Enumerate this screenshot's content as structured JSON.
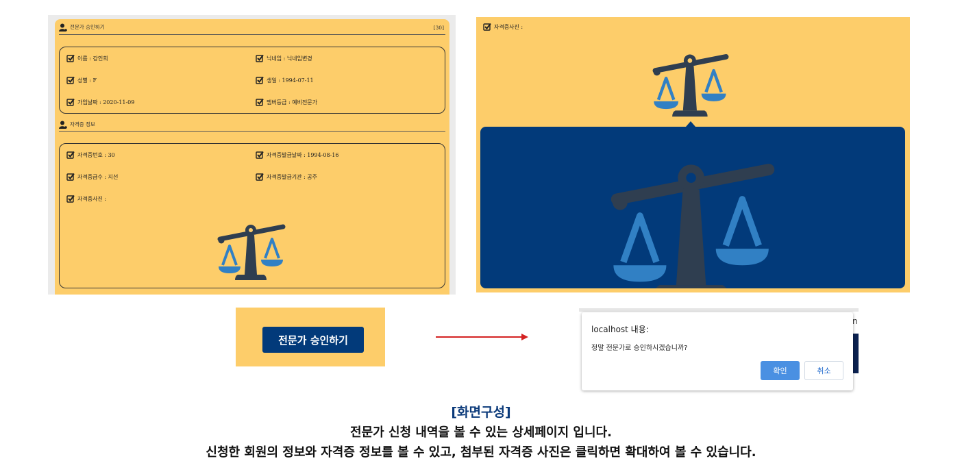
{
  "left": {
    "member_section": {
      "title": "전문가 승인하기",
      "count": "[30]",
      "fields": [
        {
          "label": "이름 : 강인희"
        },
        {
          "label": "닉네임 : 닉네임변경"
        },
        {
          "label": "성별 : F"
        },
        {
          "label": "생일 : 1994-07-11"
        },
        {
          "label": "가입날짜 : 2020-11-09"
        },
        {
          "label": "멤버등급 : 예비전문가"
        }
      ]
    },
    "cert_section": {
      "title": "자격증 정보",
      "fields": [
        {
          "label": "자격증번호 : 30"
        },
        {
          "label": "자격증발급날짜 : 1994-08-16"
        },
        {
          "label": "자격증급수 : 지선"
        },
        {
          "label": "자격증발급기관 : 공주"
        },
        {
          "label": "자격증사진 :"
        }
      ]
    }
  },
  "right": {
    "label": "자격증사진 :"
  },
  "approve_button": {
    "label": "전문가 승인하기"
  },
  "dialog": {
    "title": "localhost 내용:",
    "message": "정말 전문가로 승인하시겠습니까?",
    "ok": "확인",
    "cancel": "취소",
    "background_letter": "n"
  },
  "caption": {
    "title": "[화면구성]",
    "line1": "전문가 신청 내역을 볼 수 있는 상세페이지 입니다.",
    "line2": "신청한 회원의 정보와 자격증 정보를 볼 수 있고, 첨부된 자격증 사진은 클릭하면 확대하여 볼 수 있습니다."
  },
  "colors": {
    "panel_yellow": "#fdcd6a",
    "navy": "#023a7a",
    "arrow_red": "#d42222",
    "scale_dark": "#2f3e50",
    "scale_blue": "#3180c4",
    "dialog_blue": "#4a90e2"
  },
  "icons": [
    "person-icon",
    "checkbox-icon",
    "scales-of-justice-icon",
    "arrow-right-icon"
  ]
}
